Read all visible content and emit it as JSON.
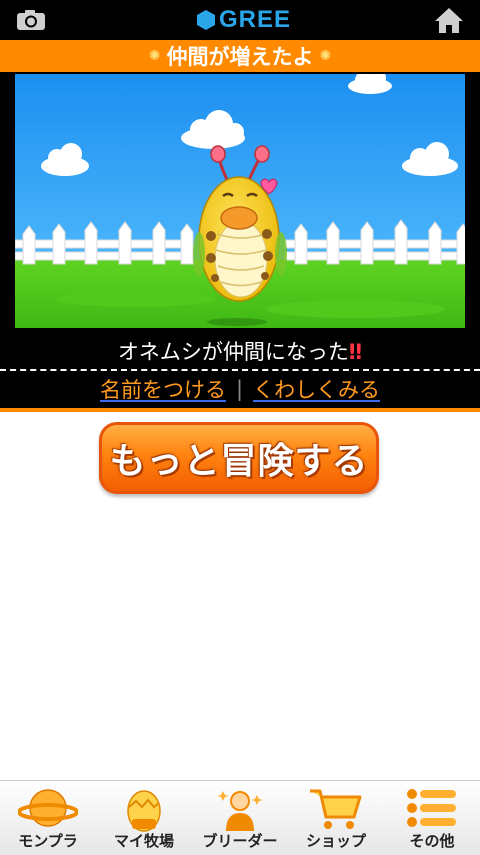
{
  "header": {
    "camera_icon": "camera-icon",
    "logo_text": "GREE",
    "home_icon": "home-icon"
  },
  "banner": {
    "title": "仲間が増えたよ"
  },
  "result": {
    "caption": "オネムシが仲間になった",
    "exclaim": "‼"
  },
  "actions": {
    "name_link": "名前をつける",
    "separator": "|",
    "detail_link": "くわしくみる",
    "adventure_button": "もっと冒険する"
  },
  "bottom_nav": [
    {
      "label": "モンプラ",
      "icon": "planet-icon"
    },
    {
      "label": "マイ牧場",
      "icon": "egg-icon"
    },
    {
      "label": "ブリーダー",
      "icon": "breeder-icon"
    },
    {
      "label": "ショップ",
      "icon": "cart-icon"
    },
    {
      "label": "その他",
      "icon": "menu-list-icon"
    }
  ],
  "colors": {
    "accent_orange": "#ff8a00",
    "gree_blue": "#2aa5e8",
    "link_orange": "#ff9a1e"
  }
}
